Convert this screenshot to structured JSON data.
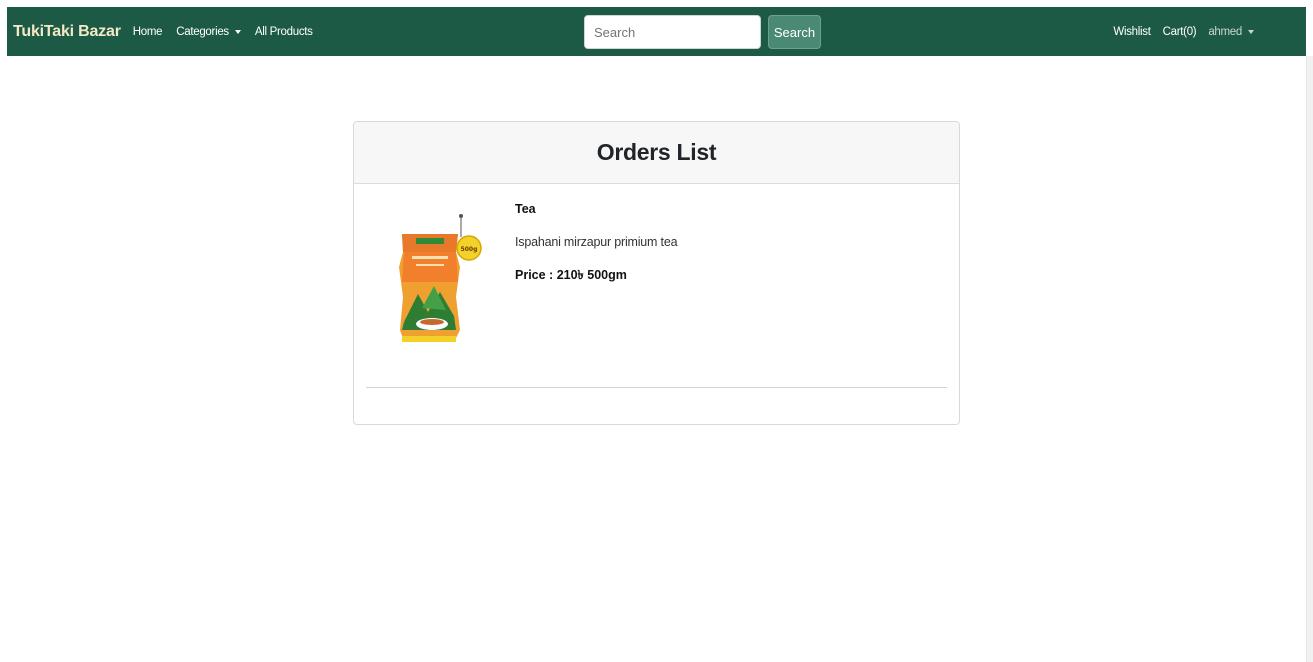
{
  "navbar": {
    "brand": "TukiTaki Bazar",
    "links": {
      "home": "Home",
      "categories": "Categories",
      "all_products": "All Products"
    },
    "search": {
      "placeholder": "Search",
      "value": "",
      "button": "Search"
    },
    "right": {
      "wishlist": "Wishlist",
      "cart": "Cart(0)",
      "user": "ahmed"
    },
    "colors": {
      "background": "#1d5a46",
      "brand": "#f3e9c6",
      "search_button": "#4a8a74"
    }
  },
  "orders": {
    "title": "Orders List",
    "items": [
      {
        "name": "Tea",
        "description": "Ispahani mirzapur primium tea",
        "price_label": "Price :",
        "price_value": "210৳",
        "unit": "500gm",
        "image": "tea-package-image",
        "image_tag": "500g"
      }
    ]
  }
}
